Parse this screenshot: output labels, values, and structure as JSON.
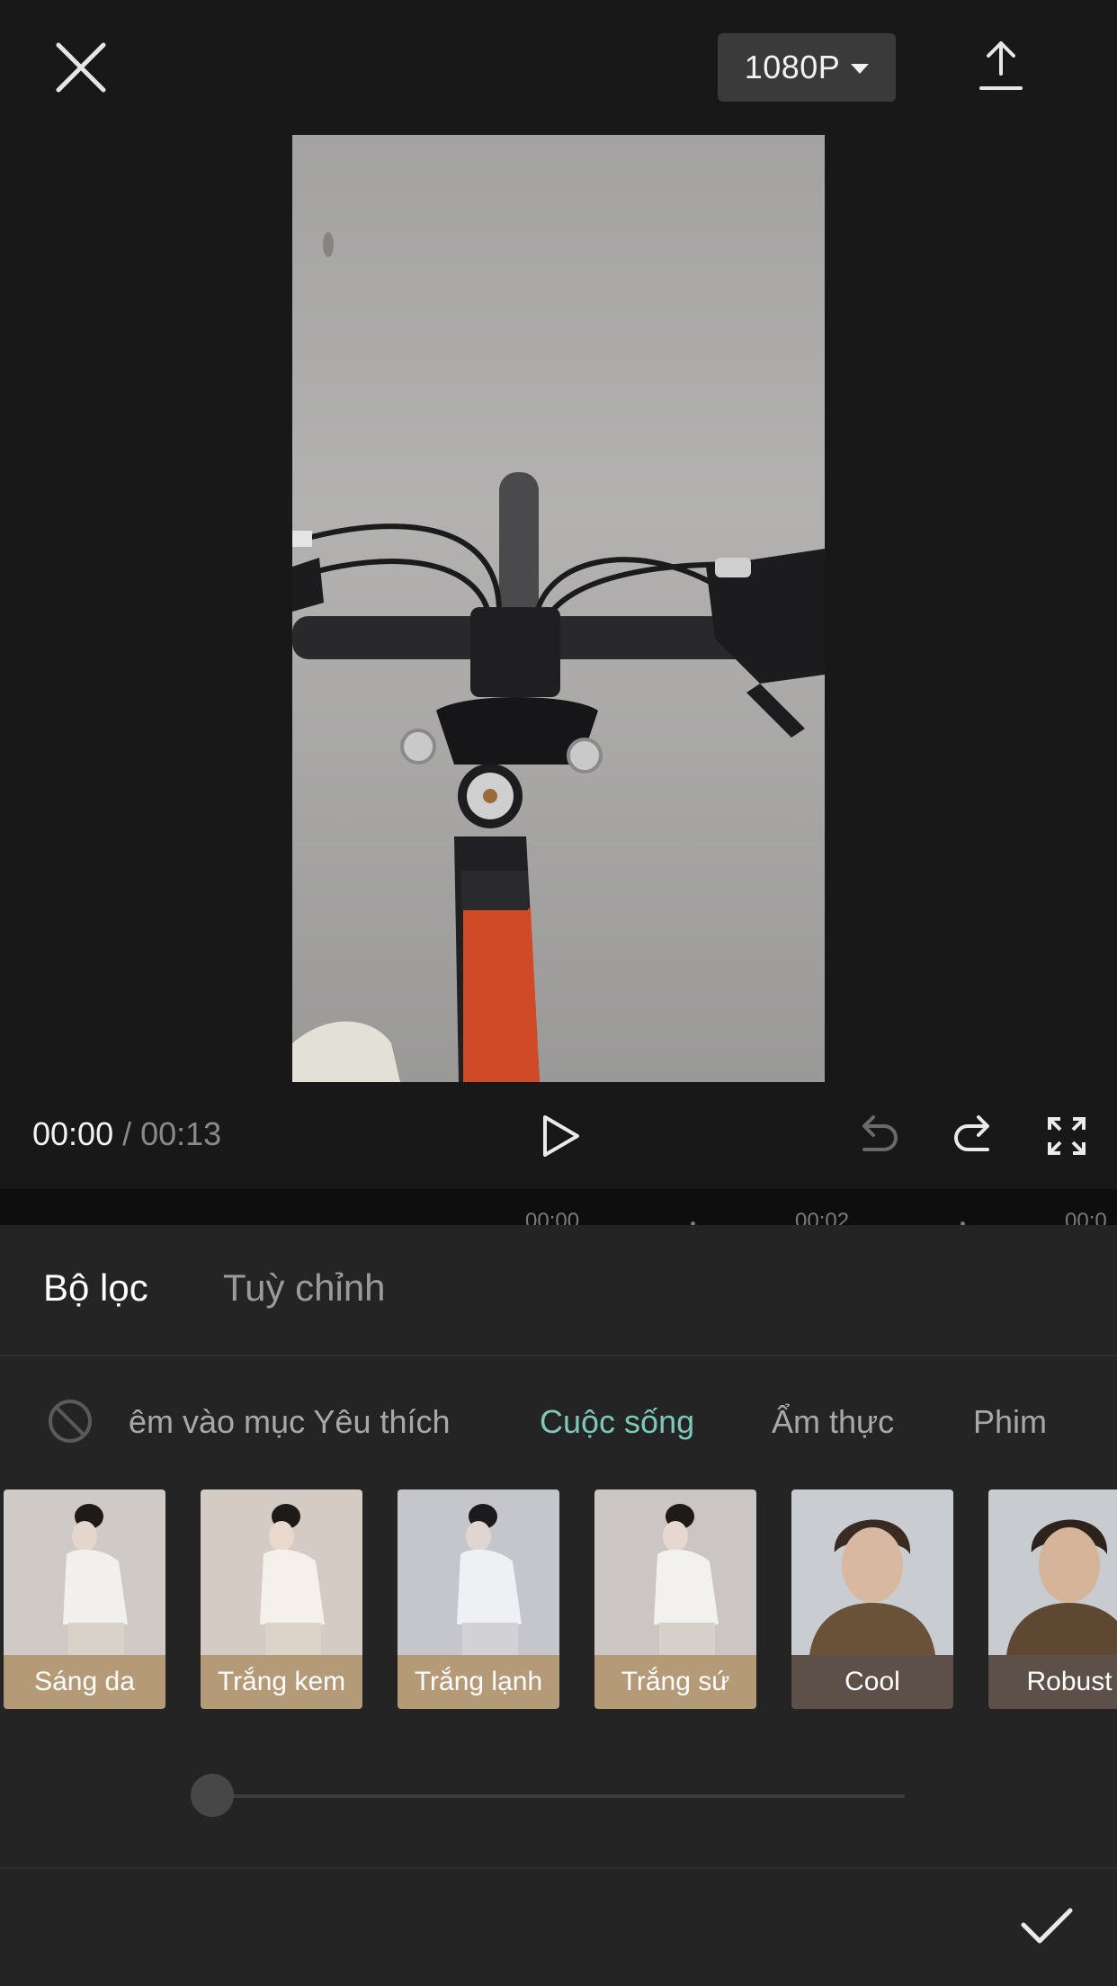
{
  "topbar": {
    "resolution_label": "1080P",
    "icons": {
      "close": "close-icon",
      "export": "upload-icon",
      "resolution_caret": "caret-down-icon"
    }
  },
  "playback": {
    "current_time": "00:00",
    "separator": "/",
    "total_time": "00:13",
    "icons": {
      "play": "play-icon",
      "undo": "undo-icon",
      "redo": "redo-icon",
      "fullscreen": "fullscreen-icon"
    }
  },
  "timeline": {
    "ticks": [
      "00:00",
      "00:02",
      "00:0"
    ]
  },
  "panel": {
    "tabs": [
      {
        "label": "Bộ lọc",
        "active": true
      },
      {
        "label": "Tuỳ chỉnh",
        "active": false
      }
    ],
    "categories": [
      {
        "label": "êm vào mục Yêu thích",
        "active": false
      },
      {
        "label": "Cuộc sống",
        "active": true
      },
      {
        "label": "Ẩm thực",
        "active": false
      },
      {
        "label": "Phim",
        "active": false
      }
    ],
    "filters": [
      {
        "label": "Sáng da",
        "label_color": "#b59a78"
      },
      {
        "label": "Trắng kem",
        "label_color": "#b59a78"
      },
      {
        "label": "Trắng lạnh",
        "label_color": "#b59a78"
      },
      {
        "label": "Trắng sứ",
        "label_color": "#b59a78"
      },
      {
        "label": "Cool",
        "label_color": "#5c5048"
      },
      {
        "label": "Robust",
        "label_color": "#5c5048"
      }
    ],
    "intensity": 0,
    "colors": {
      "active_category": "#7ec8b8",
      "panel_bg": "#242424"
    }
  }
}
